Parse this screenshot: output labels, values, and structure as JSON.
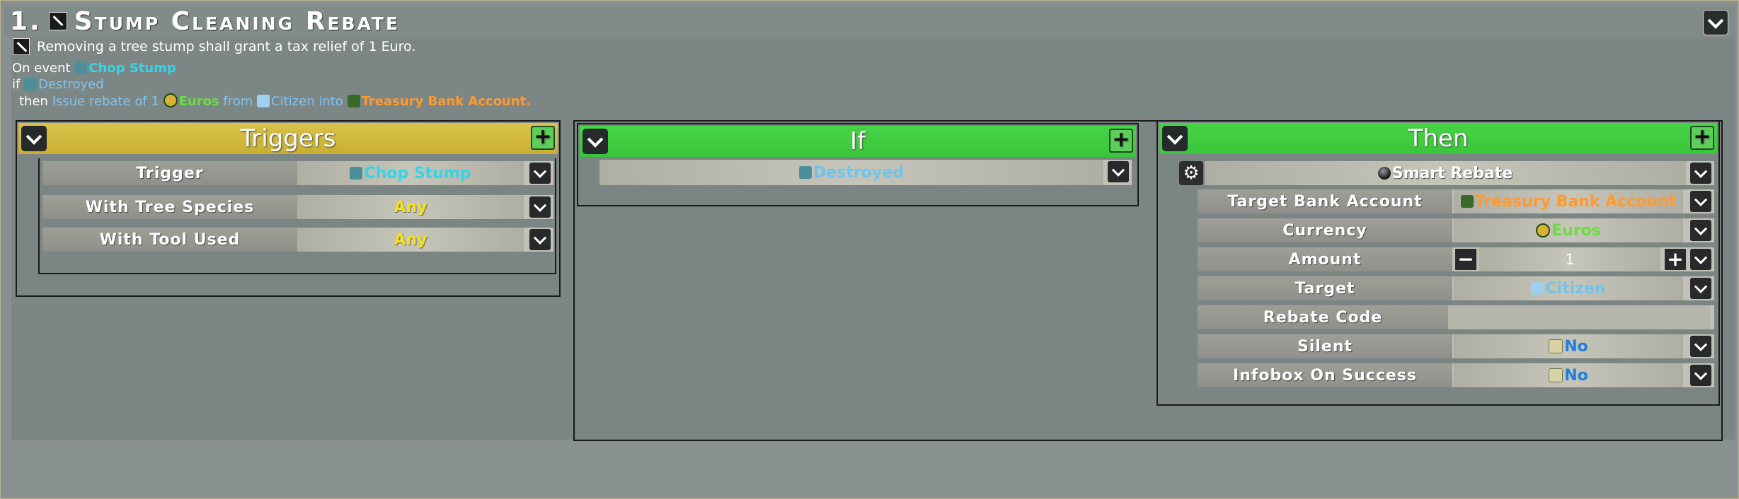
{
  "rule": {
    "number": "1.",
    "title": "Stump Cleaning Rebate",
    "description": "Removing a tree stump shall grant a tax relief of 1 Euro."
  },
  "summary": {
    "on_event_prefix": "On event",
    "event": "Chop Stump",
    "if_prefix": "if",
    "condition": "Destroyed",
    "then_prefix": "then",
    "action_text_1": "Issue rebate of 1",
    "currency": "Euros",
    "from_text": "from",
    "source": "Citizen",
    "into_text": "into",
    "target": "Treasury Bank Account."
  },
  "triggers": {
    "header": "Triggers",
    "rows": [
      {
        "label": "Trigger",
        "value": "Chop Stump",
        "icon": "stump-icon"
      },
      {
        "label": "With Tree Species",
        "value": "Any"
      },
      {
        "label": "With Tool Used",
        "value": "Any"
      }
    ]
  },
  "if_panel": {
    "header": "If",
    "condition": "Destroyed"
  },
  "then_panel": {
    "header": "Then",
    "action": "Smart Rebate",
    "rows": [
      {
        "label": "Target Bank Account",
        "value": "Treasury Bank Account"
      },
      {
        "label": "Currency",
        "value": "Euros"
      },
      {
        "label": "Amount",
        "value": "1"
      },
      {
        "label": "Target",
        "value": "Citizen"
      },
      {
        "label": "Rebate Code",
        "value": ""
      },
      {
        "label": "Silent",
        "value": "No"
      },
      {
        "label": "Infobox On Success",
        "value": "No"
      }
    ]
  },
  "colors": {
    "triggers_header": "#d4bc43",
    "if_then_header": "#42d042",
    "cyan_text": "#33d6e6",
    "orange_text": "#ff9a2e",
    "green_text": "#6cdc40",
    "yellow_text": "#f4e31c"
  }
}
